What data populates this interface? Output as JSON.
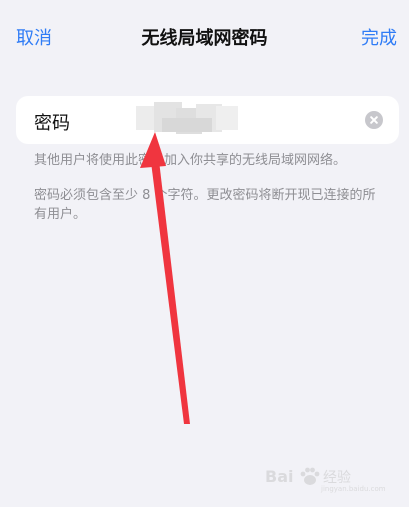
{
  "nav": {
    "cancel_label": "取消",
    "title": "无线局域网密码",
    "done_label": "完成"
  },
  "field": {
    "label": "密码",
    "value": ""
  },
  "hints": {
    "line1": "其他用户将使用此密码加入你共享的无线局域网网络。",
    "line2": "密码必须包含至少 8 个字符。更改密码将断开现已连接的所有用户。"
  },
  "watermark": {
    "brand": "Bai",
    "sub": "经验",
    "url": "jingyan.baidu.com"
  },
  "colors": {
    "accent": "#2f7cf6",
    "background": "#f2f2f7",
    "arrow": "#f0353f"
  }
}
